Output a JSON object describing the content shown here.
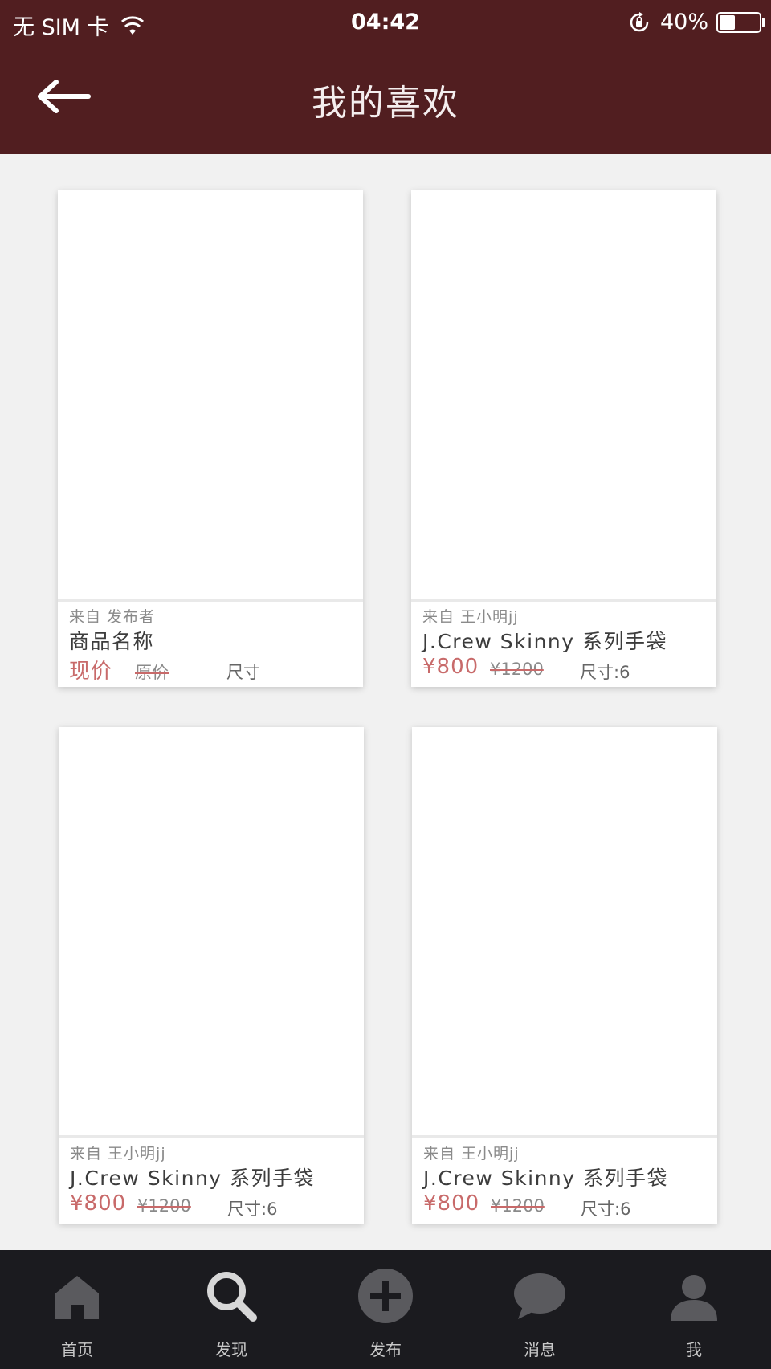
{
  "status_bar": {
    "carrier": "无 SIM 卡",
    "time": "04:42",
    "battery": "40%",
    "battery_level": 0.4,
    "icons": [
      "wifi-icon",
      "rotation-lock-icon",
      "battery-icon"
    ]
  },
  "nav": {
    "title": "我的喜欢",
    "back_icon": "arrow-left-icon"
  },
  "cards": [
    {
      "seller": "来自 发布者",
      "name": "商品名称",
      "price": "现价",
      "original_price": "原价",
      "size": "尺寸"
    },
    {
      "seller": "来自 王小明jj",
      "name": "J.Crew Skinny 系列手袋",
      "price": "¥800",
      "original_price": "¥1200",
      "size": "尺寸:6"
    },
    {
      "seller": "来自 王小明jj",
      "name": "J.Crew Skinny 系列手袋",
      "price": "¥800",
      "original_price": "¥1200",
      "size": "尺寸:6"
    },
    {
      "seller": "来自 王小明jj",
      "name": "J.Crew Skinny 系列手袋",
      "price": "¥800",
      "original_price": "¥1200",
      "size": "尺寸:6"
    }
  ],
  "tabs": [
    {
      "label": "首页",
      "icon": "home-icon"
    },
    {
      "label": "发现",
      "icon": "search-icon"
    },
    {
      "label": "发布",
      "icon": "plus-circle-icon"
    },
    {
      "label": "消息",
      "icon": "chat-bubble-icon"
    },
    {
      "label": "我",
      "icon": "user-icon"
    }
  ],
  "colors": {
    "header_bg": "#511e20",
    "price_red": "#c86a6a",
    "tabbar_bg": "#1b1b1f",
    "tab_icon": "#5a5a5e",
    "tab_icon_active": "#d7d7d7"
  }
}
